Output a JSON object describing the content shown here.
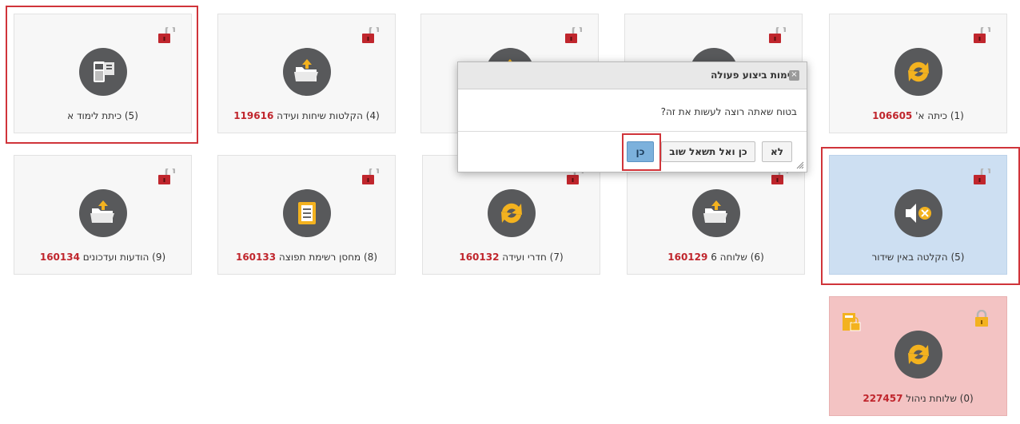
{
  "tiles": [
    {
      "number": "",
      "text": "(5) כיתת לימוד א",
      "icon": "phone-book-icon",
      "state": "normal"
    },
    {
      "number": "119616",
      "text": "(4) הקלטות שיחות ועידה",
      "icon": "folder-upload-icon",
      "state": "normal"
    },
    {
      "number": "",
      "text": "",
      "icon": "folder-upload-icon",
      "state": "normal"
    },
    {
      "number": "",
      "text": "",
      "icon": "refresh-icon",
      "state": "normal"
    },
    {
      "number": "106605",
      "text": "(1) כיתה א'",
      "icon": "refresh-icon",
      "state": "normal"
    },
    {
      "number": "160134",
      "text": "(9) הודעות ועדכונים",
      "icon": "folder-upload-icon",
      "state": "normal"
    },
    {
      "number": "160133",
      "text": "(8) מחסן רשימת תפוצה",
      "icon": "document-icon",
      "state": "normal"
    },
    {
      "number": "160132",
      "text": "(7) חדרי ועידה",
      "icon": "refresh-icon",
      "state": "normal"
    },
    {
      "number": "160129",
      "text": "(6) שלוחה 6",
      "icon": "folder-upload-icon",
      "state": "normal"
    },
    {
      "number": "",
      "text": "(5) הקלטה באין שידור",
      "icon": "speaker-mute-icon",
      "state": "selected"
    },
    {
      "number": "227457",
      "text": "(0) שלוחת ניהול",
      "icon": "refresh-icon",
      "state": "locked"
    }
  ],
  "dialog": {
    "title": "אימות ביצוע פעולה",
    "message": "בטוח שאתה רוצה לעשות את זה?",
    "btn_yes": "כן",
    "btn_yes_no_ask": "כן ואל תשאל שוב",
    "btn_no": "לא",
    "close_icon": "close-icon"
  },
  "colors": {
    "number": "#c0262d",
    "selected": "#cddff2",
    "locked": "#f3c3c3",
    "highlight": "#d0343a",
    "primary": "#7cb1dc"
  }
}
